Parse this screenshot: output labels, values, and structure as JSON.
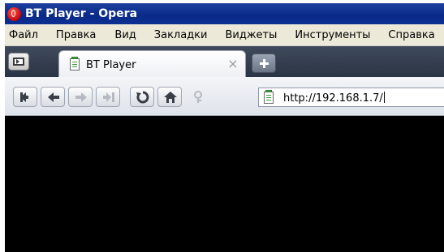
{
  "window": {
    "title": "BT Player - Opera"
  },
  "menu": {
    "items": [
      "Файл",
      "Правка",
      "Вид",
      "Закладки",
      "Виджеты",
      "Инструменты",
      "Справка"
    ]
  },
  "tabs": [
    {
      "label": "BT Player",
      "active": true
    }
  ],
  "tab_close_glyph": "×",
  "toolbar": {
    "buttons": [
      {
        "name": "rewind-icon",
        "enabled": true
      },
      {
        "name": "back-arrow-icon",
        "enabled": true
      },
      {
        "name": "forward-arrow-icon",
        "enabled": false
      },
      {
        "name": "fast-forward-icon",
        "enabled": false
      },
      {
        "name": "reload-icon",
        "enabled": true
      },
      {
        "name": "home-icon",
        "enabled": true
      },
      {
        "name": "wand-icon",
        "enabled": false
      }
    ]
  },
  "address_bar": {
    "url": "http://192.168.1.7/"
  },
  "colors": {
    "titlebar": "#0a2a88",
    "menubar": "#ece9d8",
    "tabbar": "#2b3444",
    "content": "#000000",
    "icon_enabled": "#3a3f47",
    "icon_disabled": "#b5bac2"
  }
}
